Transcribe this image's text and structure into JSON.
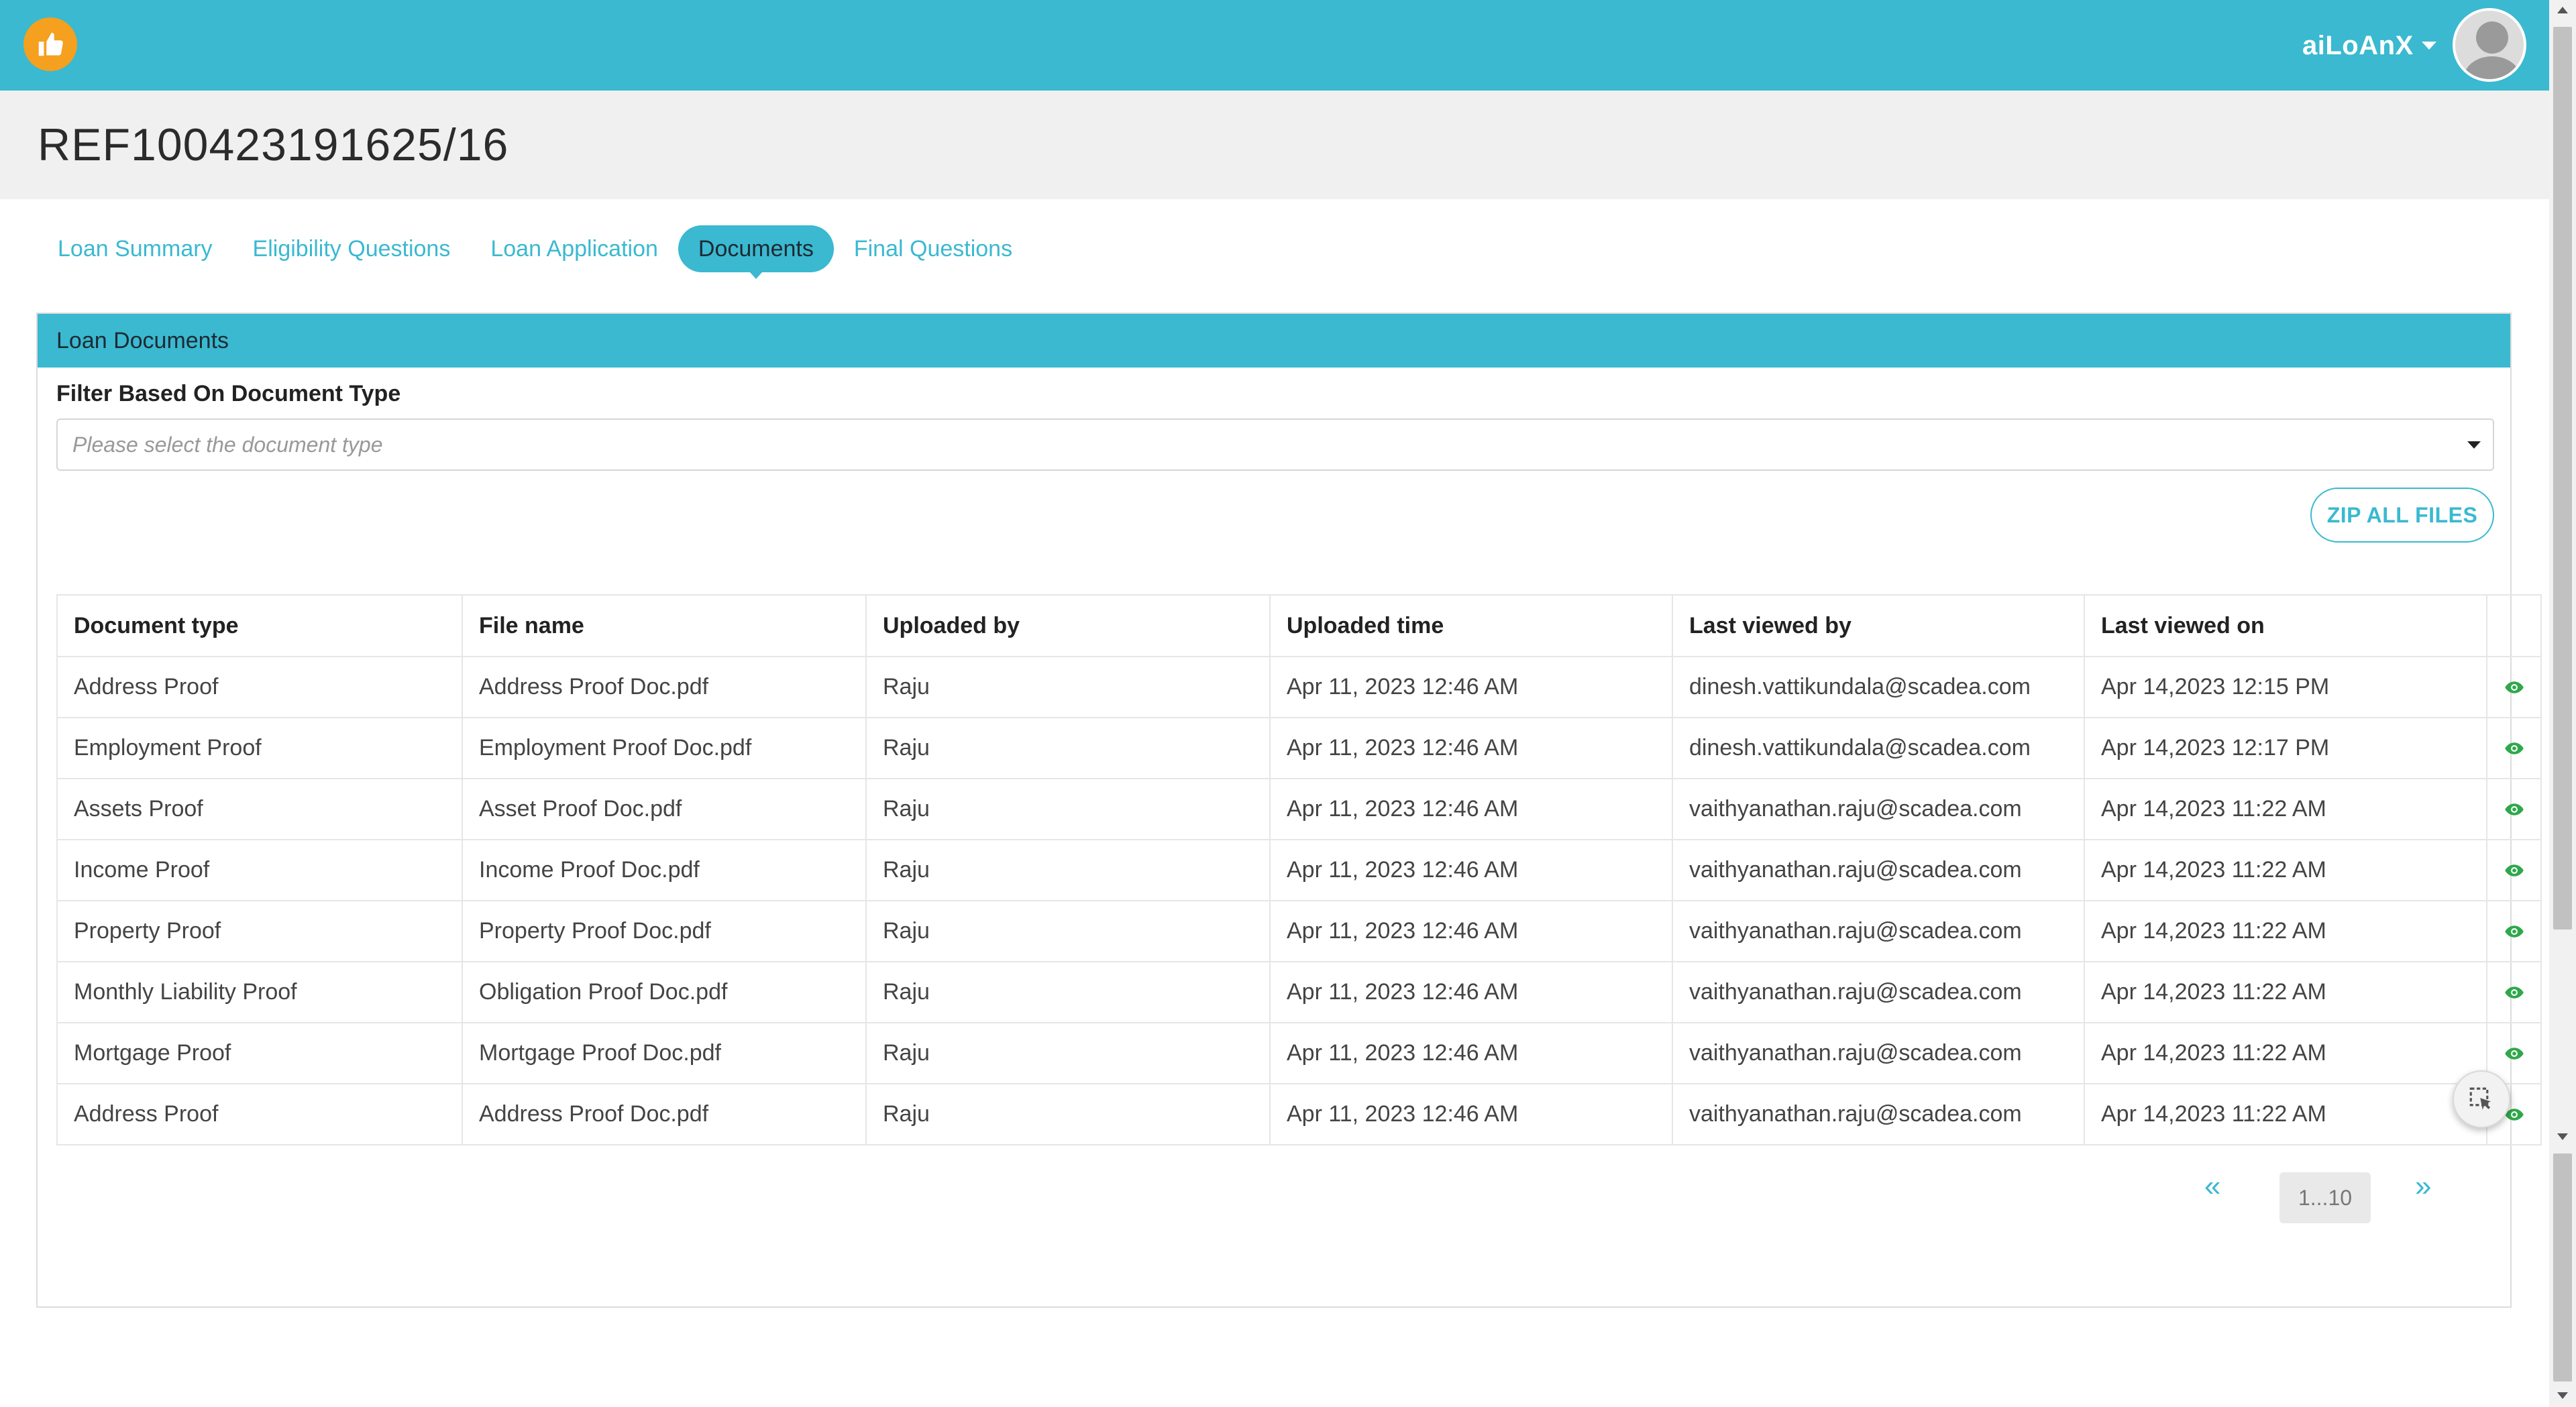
{
  "user": {
    "name": "aiLoAnX"
  },
  "header": {
    "title": "REF100423191625/16"
  },
  "tabs": [
    {
      "label": "Loan Summary",
      "active": false
    },
    {
      "label": "Eligibility Questions",
      "active": false
    },
    {
      "label": "Loan Application",
      "active": false
    },
    {
      "label": "Documents",
      "active": true
    },
    {
      "label": "Final Questions",
      "active": false
    }
  ],
  "panel": {
    "title": "Loan Documents",
    "filter_label": "Filter Based On Document Type",
    "filter_placeholder": "Please select the document type",
    "zip_button": "ZIP ALL FILES"
  },
  "table": {
    "columns": [
      "Document type",
      "File name",
      "Uploaded by",
      "Uploaded time",
      "Last viewed by",
      "Last viewed on"
    ],
    "rows": [
      [
        "Address Proof",
        "Address Proof Doc.pdf",
        "Raju",
        "Apr 11, 2023 12:46 AM",
        "dinesh.vattikundala@scadea.com",
        "Apr 14,2023 12:15 PM"
      ],
      [
        "Employment Proof",
        "Employment Proof Doc.pdf",
        "Raju",
        "Apr 11, 2023 12:46 AM",
        "dinesh.vattikundala@scadea.com",
        "Apr 14,2023 12:17 PM"
      ],
      [
        "Assets Proof",
        "Asset Proof Doc.pdf",
        "Raju",
        "Apr 11, 2023 12:46 AM",
        "vaithyanathan.raju@scadea.com",
        "Apr 14,2023 11:22 AM"
      ],
      [
        "Income Proof",
        "Income Proof Doc.pdf",
        "Raju",
        "Apr 11, 2023 12:46 AM",
        "vaithyanathan.raju@scadea.com",
        "Apr 14,2023 11:22 AM"
      ],
      [
        "Property Proof",
        "Property Proof Doc.pdf",
        "Raju",
        "Apr 11, 2023 12:46 AM",
        "vaithyanathan.raju@scadea.com",
        "Apr 14,2023 11:22 AM"
      ],
      [
        "Monthly Liability Proof",
        "Obligation Proof Doc.pdf",
        "Raju",
        "Apr 11, 2023 12:46 AM",
        "vaithyanathan.raju@scadea.com",
        "Apr 14,2023 11:22 AM"
      ],
      [
        "Mortgage Proof",
        "Mortgage Proof Doc.pdf",
        "Raju",
        "Apr 11, 2023 12:46 AM",
        "vaithyanathan.raju@scadea.com",
        "Apr 14,2023 11:22 AM"
      ],
      [
        "Address Proof",
        "Address Proof Doc.pdf",
        "Raju",
        "Apr 11, 2023 12:46 AM",
        "vaithyanathan.raju@scadea.com",
        "Apr 14,2023 11:22 AM"
      ]
    ]
  },
  "pagination": {
    "prev": "«",
    "page": "1...10",
    "next": "»"
  },
  "icons": {
    "logo": "hand-thumbs-up-icon",
    "row_action": "eye-icon",
    "floating": "cursor-select-icon"
  },
  "colors": {
    "brand": "#3ab9d1",
    "logo": "#f5a01f",
    "eye": "#2ea84a"
  }
}
